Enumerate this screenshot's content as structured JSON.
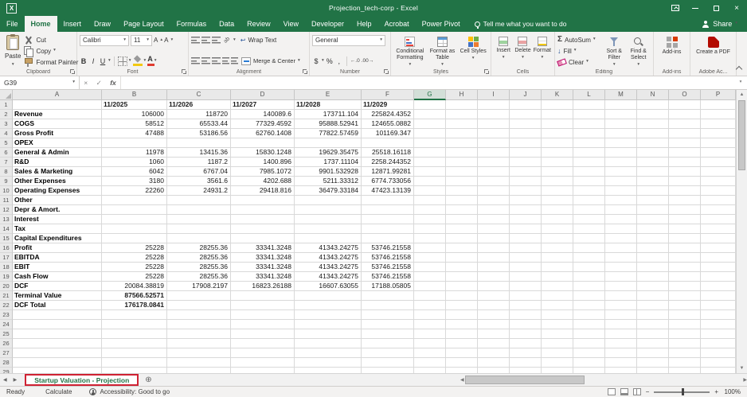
{
  "icons": {
    "caret_down": "▾",
    "caret_up": "▴",
    "close": "×",
    "check": "✓",
    "fx": "fx",
    "sigma": "Σ",
    "arrow_down": "↓",
    "wrap_return": "↩",
    "orientation": "ab",
    "excel_logo": "X",
    "font_grow": "A",
    "font_shrink": "A",
    "font_color": "A",
    "plus_circle": "⊕",
    "nav_left": "◀",
    "nav_right": "▶",
    "scroll_up": "▲",
    "scroll_down": "▼",
    "minus": "−",
    "plus": "+",
    "increase_decimal": "←.0",
    "decrease_decimal": ".00→"
  },
  "colors": {
    "brand_green": "#217346",
    "annotation_red": "#cf2233"
  },
  "titlebar": {
    "title": "Projection_tech-corp - Excel"
  },
  "menu": {
    "tabs": [
      "File",
      "Home",
      "Insert",
      "Draw",
      "Page Layout",
      "Formulas",
      "Data",
      "Review",
      "View",
      "Developer",
      "Help",
      "Acrobat",
      "Power Pivot"
    ],
    "active_tab": "Home",
    "tell_me": "Tell me what you want to do",
    "share": "Share"
  },
  "ribbon": {
    "clipboard": {
      "group": "Clipboard",
      "paste": "Paste",
      "cut": "Cut",
      "copy": "Copy",
      "format_painter": "Format Painter"
    },
    "font": {
      "group": "Font",
      "name": "Calibri",
      "size": "11",
      "bold": "B",
      "italic": "I",
      "underline": "U"
    },
    "alignment": {
      "group": "Alignment",
      "wrap": "Wrap Text",
      "merge": "Merge & Center"
    },
    "number": {
      "group": "Number",
      "format": "General",
      "currency": "$",
      "percent": "%",
      "comma": ","
    },
    "styles": {
      "group": "Styles",
      "conditional": "Conditional Formatting",
      "format_table": "Format as Table",
      "cell_styles": "Cell Styles"
    },
    "cells": {
      "group": "Cells",
      "insert": "Insert",
      "delete": "Delete",
      "format": "Format"
    },
    "editing": {
      "group": "Editing",
      "autosum": "AutoSum",
      "fill": "Fill",
      "clear": "Clear",
      "sort_filter": "Sort & Filter",
      "find_select": "Find & Select"
    },
    "addins": {
      "group": "Add-ins",
      "button": "Add-ins"
    },
    "adobe": {
      "group": "Adobe Ac...",
      "create_pdf": "Create a PDF"
    }
  },
  "formula_bar": {
    "name_box": "G39",
    "formula": ""
  },
  "grid": {
    "column_headers": [
      "A",
      "B",
      "C",
      "D",
      "E",
      "F",
      "G",
      "H",
      "I",
      "J",
      "K",
      "L",
      "M",
      "N",
      "O",
      "P"
    ],
    "selected_column": "G",
    "selected_cell": "G39",
    "visible_rows": 29,
    "rows": [
      {
        "n": 1,
        "label": "",
        "values": [
          "11/2025",
          "11/2026",
          "11/2027",
          "11/2028",
          "11/2029"
        ],
        "type": "dates"
      },
      {
        "n": 2,
        "label": "Revenue",
        "values": [
          "106000",
          "118720",
          "140089.6",
          "173711.104",
          "225824.4352"
        ]
      },
      {
        "n": 3,
        "label": "COGS",
        "values": [
          "58512",
          "65533.44",
          "77329.4592",
          "95888.52941",
          "124655.0882"
        ]
      },
      {
        "n": 4,
        "label": "Gross Profit",
        "values": [
          "47488",
          "53186.56",
          "62760.1408",
          "77822.57459",
          "101169.347"
        ]
      },
      {
        "n": 5,
        "label": "OPEX",
        "values": [
          "",
          "",
          "",
          "",
          ""
        ]
      },
      {
        "n": 6,
        "label": "General & Admin",
        "values": [
          "11978",
          "13415.36",
          "15830.1248",
          "19629.35475",
          "25518.16118"
        ]
      },
      {
        "n": 7,
        "label": "R&D",
        "values": [
          "1060",
          "1187.2",
          "1400.896",
          "1737.11104",
          "2258.244352"
        ]
      },
      {
        "n": 8,
        "label": "Sales & Marketing",
        "values": [
          "6042",
          "6767.04",
          "7985.1072",
          "9901.532928",
          "12871.99281"
        ]
      },
      {
        "n": 9,
        "label": "Other Expenses",
        "values": [
          "3180",
          "3561.6",
          "4202.688",
          "5211.33312",
          "6774.733056"
        ]
      },
      {
        "n": 10,
        "label": "Operating Expenses",
        "values": [
          "22260",
          "24931.2",
          "29418.816",
          "36479.33184",
          "47423.13139"
        ]
      },
      {
        "n": 11,
        "label": "Other",
        "values": [
          "",
          "",
          "",
          "",
          ""
        ]
      },
      {
        "n": 12,
        "label": "Depr & Amort.",
        "values": [
          "",
          "",
          "",
          "",
          ""
        ]
      },
      {
        "n": 13,
        "label": "Interest",
        "values": [
          "",
          "",
          "",
          "",
          ""
        ]
      },
      {
        "n": 14,
        "label": "Tax",
        "values": [
          "",
          "",
          "",
          "",
          ""
        ]
      },
      {
        "n": 15,
        "label": "Capital Expenditures",
        "values": [
          "",
          "",
          "",
          "",
          ""
        ]
      },
      {
        "n": 16,
        "label": "Profit",
        "values": [
          "25228",
          "28255.36",
          "33341.3248",
          "41343.24275",
          "53746.21558"
        ]
      },
      {
        "n": 17,
        "label": "EBITDA",
        "values": [
          "25228",
          "28255.36",
          "33341.3248",
          "41343.24275",
          "53746.21558"
        ]
      },
      {
        "n": 18,
        "label": "EBIT",
        "values": [
          "25228",
          "28255.36",
          "33341.3248",
          "41343.24275",
          "53746.21558"
        ]
      },
      {
        "n": 19,
        "label": "Cash Flow",
        "values": [
          "25228",
          "28255.36",
          "33341.3248",
          "41343.24275",
          "53746.21558"
        ]
      },
      {
        "n": 20,
        "label": "DCF",
        "values": [
          "20084.38819",
          "17908.2197",
          "16823.26188",
          "16607.63055",
          "17188.05805"
        ]
      },
      {
        "n": 21,
        "label": "Terminal Value",
        "values": [
          "87566.52571",
          "",
          "",
          "",
          ""
        ],
        "bold_values": true
      },
      {
        "n": 22,
        "label": "DCF Total",
        "values": [
          "176178.0841",
          "",
          "",
          "",
          ""
        ],
        "bold_values": true
      }
    ]
  },
  "sheet_bar": {
    "active_tab": "Startup Valuation - Projection"
  },
  "status_bar": {
    "mode": "Ready",
    "calculate": "Calculate",
    "accessibility": "Accessibility: Good to go",
    "zoom": "100%"
  }
}
